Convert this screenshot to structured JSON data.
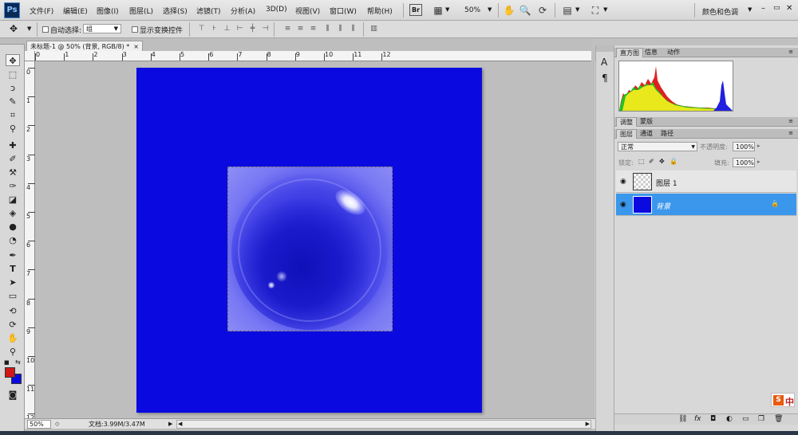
{
  "app": {
    "logo": "Ps"
  },
  "menu": [
    "文件(F)",
    "编辑(E)",
    "图像(I)",
    "图层(L)",
    "选择(S)",
    "滤镜(T)",
    "分析(A)",
    "3D(D)",
    "视图(V)",
    "窗口(W)",
    "帮助(H)"
  ],
  "toolbar": {
    "bridge_label": "Br",
    "zoom_value": "50%",
    "workspace": "颜色和色调"
  },
  "window_controls": {
    "minimize": "–",
    "restore": "▭",
    "close": "✕"
  },
  "options": {
    "auto_select_label": "自动选择:",
    "auto_select_value": "组",
    "show_transform_label": "显示变换控件"
  },
  "document": {
    "tab_title": "未标题-1 @ 50% (背景, RGB/8) *",
    "close_glyph": "×",
    "ruler_h": [
      "0",
      "1",
      "2",
      "3",
      "4",
      "5",
      "6",
      "7",
      "8",
      "9",
      "10",
      "11",
      "12"
    ],
    "ruler_v": [
      "0",
      "1",
      "2",
      "3",
      "4",
      "5",
      "6",
      "7",
      "8",
      "9",
      "10",
      "11",
      "12"
    ],
    "zoom_status": "50%",
    "doc_status": "文档:3.99M/3.47M",
    "canvas_color": "#0a0ae0"
  },
  "panel_strip": [
    "A",
    "¶"
  ],
  "panels": {
    "top_tabs": [
      "直方图",
      "信息",
      "动作"
    ],
    "mid_tabs": [
      "调整",
      "蒙版"
    ],
    "layer_tabs": [
      "图层",
      "通道",
      "路径"
    ],
    "blend_mode": "正常",
    "opacity_label": "不透明度:",
    "opacity_value": "100%",
    "lock_label": "锁定:",
    "fill_label": "填充:",
    "fill_value": "100%",
    "layers": [
      {
        "name": "图层 1",
        "selected": false
      },
      {
        "name": "背景",
        "selected": true
      }
    ],
    "footer_fx": "fx"
  },
  "ime": {
    "badge": "S",
    "label": "中"
  }
}
